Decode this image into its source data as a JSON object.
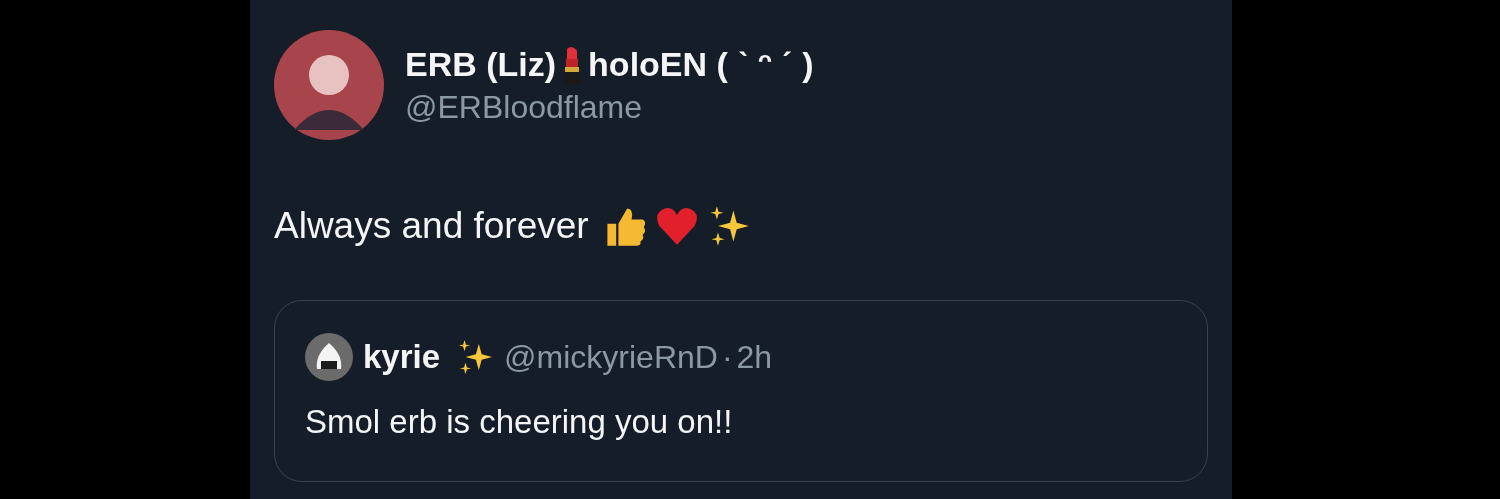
{
  "tweet": {
    "author": {
      "name": "ERB (Liz)",
      "name_suffix": "holoEN ( ˋ ᵔ ˊ )",
      "handle": "@ERBloodflame"
    },
    "text": "Always and forever",
    "quote": {
      "author": {
        "name": "kyrie",
        "handle": "@mickyrieRnD",
        "separator": "·",
        "time": "2h"
      },
      "text": "Smol erb is cheering you on!!"
    }
  }
}
